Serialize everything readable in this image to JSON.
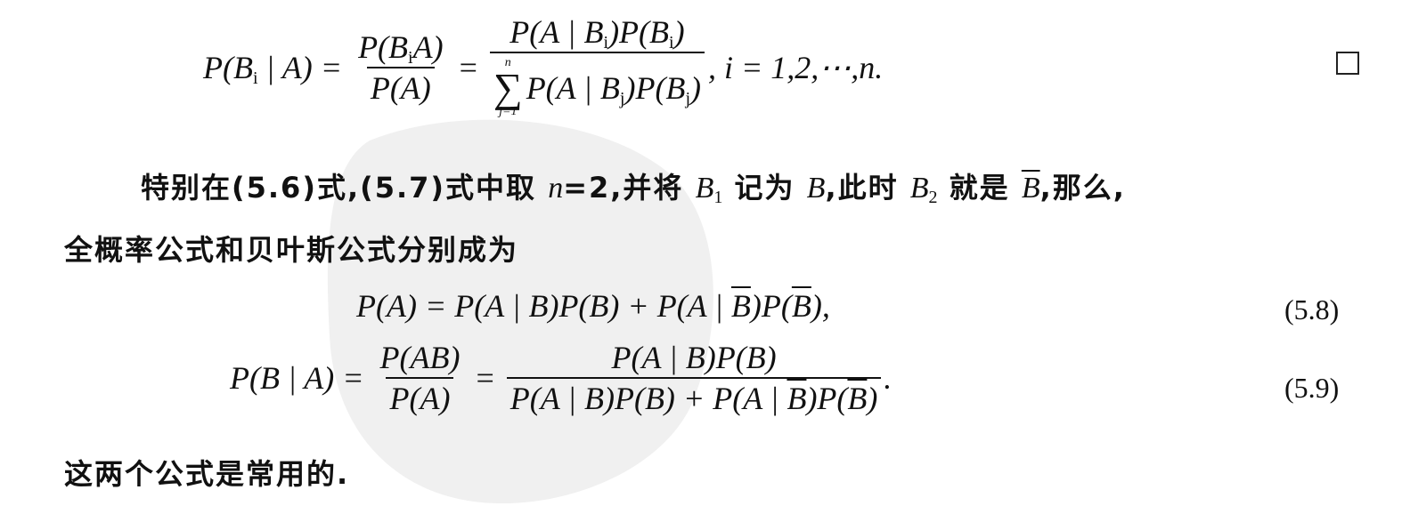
{
  "eq_bayes_general": {
    "lhs": "P(B",
    "lhs_sub": "i",
    "lhs_tail": " | A) =",
    "frac1_num": "P(B",
    "frac1_num_sub": "i",
    "frac1_num_tail": "A)",
    "frac1_den": "P(A)",
    "eq2": "=",
    "frac2_num_a": "P(A | B",
    "frac2_num_sub1": "i",
    "frac2_num_b": ")P(B",
    "frac2_num_sub2": "i",
    "frac2_num_c": ")",
    "sum_upper": "n",
    "sum_symbol": "∑",
    "sum_lower": "j=1",
    "frac2_den_a": "P(A | B",
    "frac2_den_sub1": "j",
    "frac2_den_b": ")P(B",
    "frac2_den_sub2": "j",
    "frac2_den_c": ")",
    "index_range": ", i = 1,2,⋯,n."
  },
  "paragraph1": {
    "line1_a": "特别在(5.6)式,(5.7)式中取",
    "line1_n": "n",
    "line1_b": "=2,并将",
    "line1_B1": "B",
    "line1_B1_sub": "1",
    "line1_c": "记为",
    "line1_B": "B",
    "line1_d": ",此时",
    "line1_B2": "B",
    "line1_B2_sub": "2",
    "line1_e": "就是",
    "line1_Bbar": "B",
    "line1_f": ",那么,",
    "line2": "全概率公式和贝叶斯公式分别成为"
  },
  "eq_5_8": {
    "a": "P(A) = P(A | B)P(B) + P(A | ",
    "bar1": "B",
    "b": ")P(",
    "bar2": "B",
    "c": "),",
    "number": "(5.8)"
  },
  "eq_5_9": {
    "lhs": "P(B | A) =",
    "frac1_num": "P(AB)",
    "frac1_den": "P(A)",
    "eq2": "=",
    "frac2_num": "P(A | B)P(B)",
    "frac2_den_a": "P(A | B)P(B) + P(A | ",
    "frac2_den_bar1": "B",
    "frac2_den_b": ")P(",
    "frac2_den_bar2": "B",
    "frac2_den_c": ")",
    "tail": ".",
    "number": "(5.9)"
  },
  "closing_sentence": "这两个公式是常用的.",
  "colors": {
    "ink": "#111111",
    "watermark": "#f0f0f0"
  }
}
